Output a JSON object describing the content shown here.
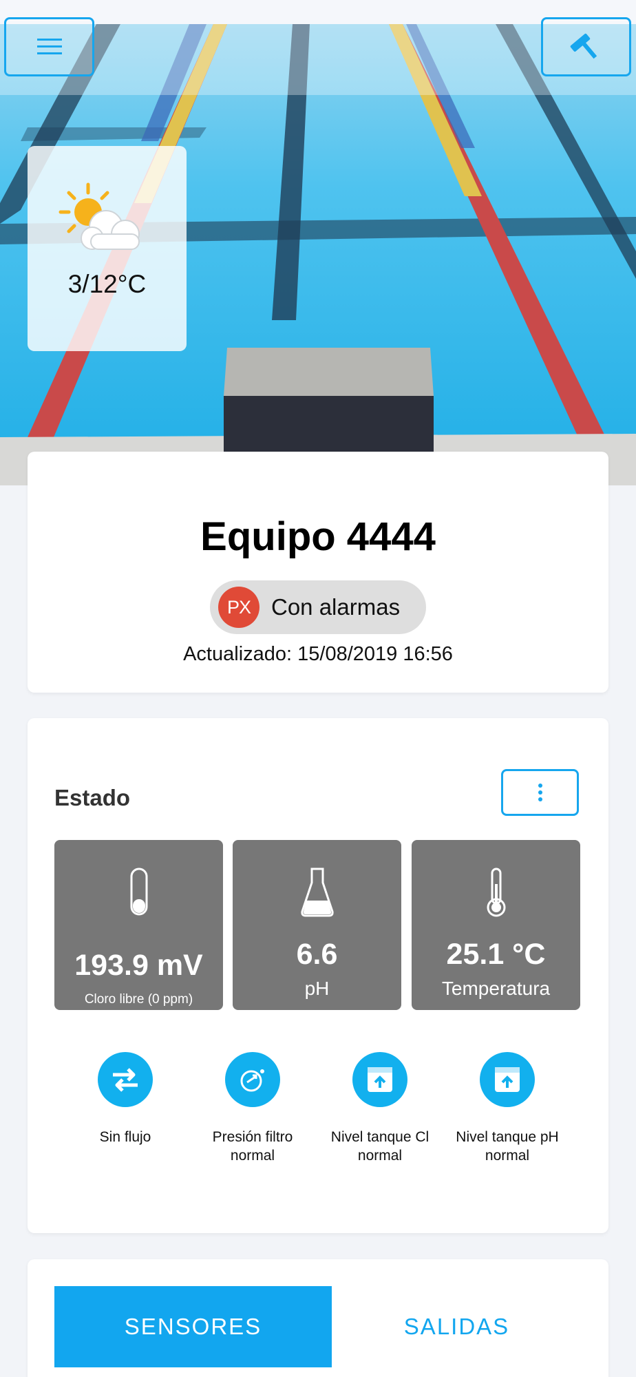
{
  "header": {
    "menu_icon": "hamburger-menu-icon",
    "tool_icon": "hammer-icon"
  },
  "weather": {
    "icon": "partly-sunny-icon",
    "temperature": "3/12°C"
  },
  "device": {
    "title": "Equipo 4444",
    "status_badge": "PX",
    "status": "Con alarmas",
    "status_color": "#e04a37",
    "updated": "Actualizado: 15/08/2019 16:56"
  },
  "estado": {
    "title": "Estado",
    "more_icon": "more-vertical-icon",
    "tiles": [
      {
        "icon": "test-tube-icon",
        "value": "193.9 mV",
        "label": "Cloro libre (0 ppm)"
      },
      {
        "icon": "flask-icon",
        "value": "6.6",
        "label": "pH"
      },
      {
        "icon": "thermometer-icon",
        "value": "25.1 °C",
        "label": "Temperatura"
      }
    ],
    "indicators": [
      {
        "icon": "flow-arrows-icon",
        "label": "Sin flujo"
      },
      {
        "icon": "filter-pressure-icon",
        "label": "Presión filtro normal"
      },
      {
        "icon": "tank-level-icon",
        "label": "Nivel tanque Cl normal"
      },
      {
        "icon": "tank-level-icon",
        "label": "Nivel tanque pH normal"
      }
    ]
  },
  "tabs": {
    "sensores": "SENSORES",
    "salidas": "SALIDAS",
    "active": "SENSORES"
  },
  "colors": {
    "accent": "#12a6ef",
    "tile_bg": "#777777",
    "alarm": "#e04a37"
  }
}
